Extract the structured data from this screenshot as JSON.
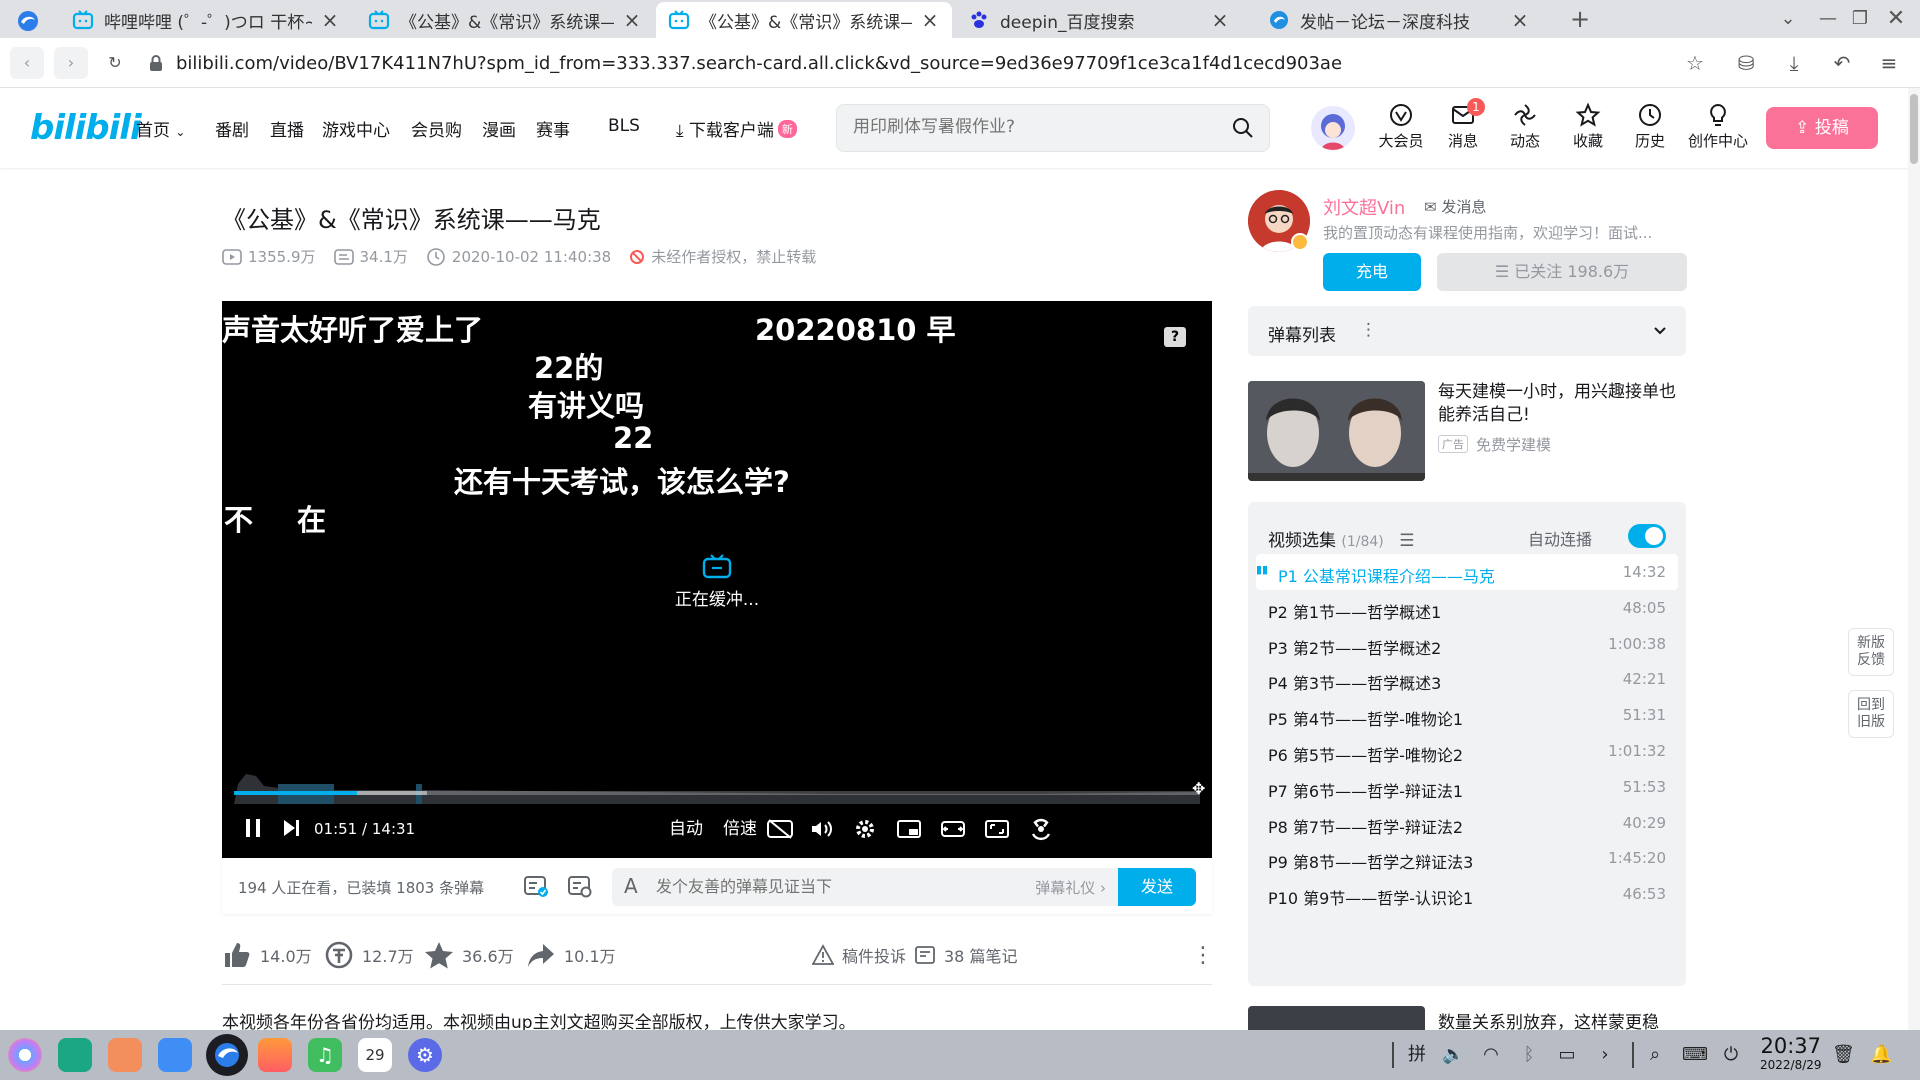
{
  "browser": {
    "tabs": [
      {
        "title": "哔哩哔哩 (゜-゜)つロ 干杯~-bilibili",
        "active": false
      },
      {
        "title": "《公基》&《常识》系统课——马克",
        "active": false
      },
      {
        "title": "《公基》&《常识》系统课——马克",
        "active": true
      },
      {
        "title": "deepin_百度搜索",
        "active": false
      },
      {
        "title": "发帖－论坛－深度科技",
        "active": false
      }
    ],
    "url": "bilibili.com/video/BV17K411N7hU?spm_id_from=333.337.search-card.all.click&vd_source=9ed36e97709f1ce3ca1f4d1cecd903ae",
    "new_tab": "+"
  },
  "header": {
    "logo": "bilibili",
    "nav": [
      "首页",
      "番剧",
      "直播",
      "游戏中心",
      "会员购",
      "漫画",
      "赛事",
      "BLS"
    ],
    "download": "下载客户端",
    "new_badge": "新",
    "search_placeholder": "用印刷体写暑假作业?",
    "right": [
      {
        "label": "大会员",
        "icon": "vip-icon"
      },
      {
        "label": "消息",
        "icon": "message-icon",
        "badge": "1"
      },
      {
        "label": "动态",
        "icon": "dynamic-icon"
      },
      {
        "label": "收藏",
        "icon": "star-icon"
      },
      {
        "label": "历史",
        "icon": "clock-icon"
      },
      {
        "label": "创作中心",
        "icon": "bulb-icon"
      }
    ],
    "upload": "投稿"
  },
  "video": {
    "title": "《公基》&《常识》系统课——马克",
    "views": "1355.9万",
    "danmaku_count": "34.1万",
    "date": "2020-10-02 11:40:38",
    "copyright": "未经作者授权，禁止转载"
  },
  "player": {
    "danmaku": [
      "声音太好听了爱上了",
      "20220810 早",
      "22的",
      "有讲义吗",
      "22",
      "还有十天考试，该怎么学?",
      "不",
      "在"
    ],
    "buffering": "正在缓冲...",
    "current_time": "01:51",
    "separator": "/",
    "total_time": "14:31",
    "played_fraction": 0.127,
    "buffered_fraction": 0.2,
    "quality": "自动",
    "speed": "倍速"
  },
  "sending": {
    "online": "194 人正在看，已装填 1803 条弹幕",
    "placeholder": "发个友善的弹幕见证当下",
    "etiquette": "弹幕礼仪",
    "send": "发送"
  },
  "actions": {
    "like": "14.0万",
    "coin": "12.7万",
    "fav": "36.6万",
    "share": "10.1万",
    "report": "稿件投诉",
    "notes": "38 篇笔记"
  },
  "description": "本视频各年份各省份均适用。本视频由up主刘文超购买全部版权，上传供大家学习。",
  "uploader": {
    "name": "刘文超Vin",
    "message": "发消息",
    "signature": "我的置顶动态有课程使用指南，欢迎学习！面试...",
    "charge": "充电",
    "follow": "已关注 198.6万"
  },
  "danmaku_list": {
    "title": "弹幕列表"
  },
  "ad": {
    "title": "每天建模一小时，用兴趣接单也能养活自己!",
    "tag": "广告",
    "source": "免费学建模"
  },
  "playlist": {
    "title": "视频选集",
    "count": "(1/84)",
    "autoplay": "自动连播",
    "autoplay_on": true,
    "episodes": [
      {
        "label": "P1  公基常识课程介绍——马克",
        "duration": "14:32",
        "active": true
      },
      {
        "label": "P2  第1节——哲学概述1",
        "duration": "48:05"
      },
      {
        "label": "P3  第2节——哲学概述2",
        "duration": "1:00:38"
      },
      {
        "label": "P4  第3节——哲学概述3",
        "duration": "42:21"
      },
      {
        "label": "P5  第4节——哲学-唯物论1",
        "duration": "51:31"
      },
      {
        "label": "P6  第5节——哲学-唯物论2",
        "duration": "1:01:32"
      },
      {
        "label": "P7  第6节——哲学-辩证法1",
        "duration": "51:53"
      },
      {
        "label": "P8  第7节——哲学-辩证法2",
        "duration": "40:29"
      },
      {
        "label": "P9  第8节——哲学之辩证法3",
        "duration": "1:45:20"
      },
      {
        "label": "P10  第9节——哲学-认识论1",
        "duration": "46:53"
      }
    ]
  },
  "rec2": {
    "title": "数量关系别放弃，这样蒙更稳"
  },
  "float": {
    "feedback": "新版反馈",
    "old": "回到旧版"
  },
  "taskbar": {
    "time": "20:37",
    "date": "2022/8/29",
    "calendar_day": "29",
    "ime": "拼"
  },
  "colors": {
    "brand": "#00aeec",
    "pink": "#fb7299",
    "taskbar": "#b7bcc5"
  }
}
